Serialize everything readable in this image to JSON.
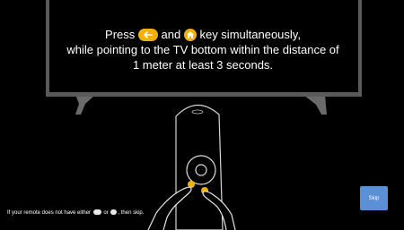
{
  "instruction": {
    "press": "Press",
    "and": "and",
    "key_simultaneously": "key simultaneously,",
    "line2": "while pointing to the TV bottom within the distance of",
    "line3": "1 meter at least 3 seconds."
  },
  "hint": {
    "prefix": "If your remote does not have either",
    "or": "or",
    "suffix": ", then skip."
  },
  "skip_button": {
    "label": "Skip"
  },
  "colors": {
    "background": "#000000",
    "tv_panel": "#5a5a5a",
    "key_badge": "#f2b100",
    "skip_button": "#5b8fd6"
  },
  "icons": {
    "back_key": "back-arrow-icon",
    "home_key": "home-icon"
  }
}
